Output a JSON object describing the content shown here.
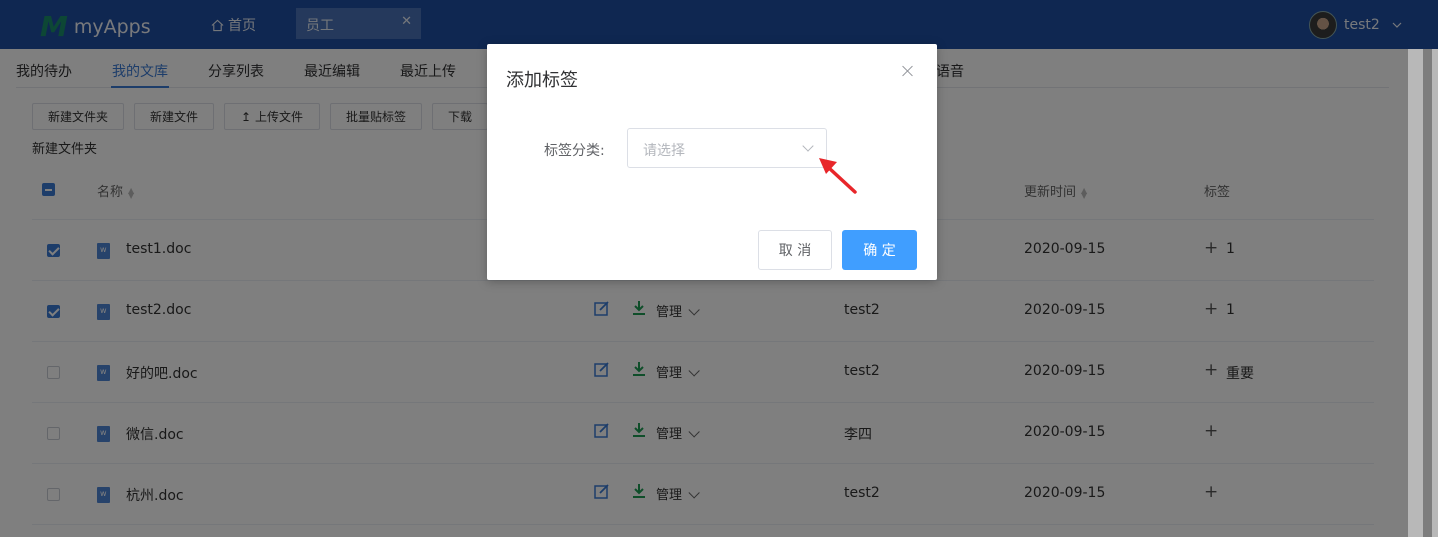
{
  "header": {
    "logo_mark": "M",
    "app_name": "myApps",
    "home_label": "首页",
    "active_tab": "员工",
    "user_name": "test2"
  },
  "subnav": {
    "items": [
      "我的待办",
      "我的文库",
      "分享列表",
      "最近编辑",
      "最近上传",
      "语音"
    ],
    "active_index": 1
  },
  "toolbar": {
    "buttons": [
      "新建文件夹",
      "新建文件",
      "上传文件",
      "批量贴标签",
      "下载"
    ],
    "breadcrumb": "新建文件夹"
  },
  "table": {
    "headers": {
      "name": "名称",
      "updated": "更新时间",
      "tags": "标签"
    },
    "manage_label": "管理",
    "rows": [
      {
        "name": "test1.doc",
        "owner": "",
        "updated": "2020-09-15",
        "tag": "1",
        "checked": true
      },
      {
        "name": "test2.doc",
        "owner": "test2",
        "updated": "2020-09-15",
        "tag": "1",
        "checked": true
      },
      {
        "name": "好的吧.doc",
        "owner": "test2",
        "updated": "2020-09-15",
        "tag": "重要",
        "checked": false
      },
      {
        "name": "微信.doc",
        "owner": "李四",
        "updated": "2020-09-15",
        "tag": "",
        "checked": false
      },
      {
        "name": "杭州.doc",
        "owner": "test2",
        "updated": "2020-09-15",
        "tag": "",
        "checked": false
      }
    ]
  },
  "dialog": {
    "title": "添加标签",
    "field_label": "标签分类:",
    "select_placeholder": "请选择",
    "cancel_label": "取 消",
    "ok_label": "确 定"
  },
  "colors": {
    "header_bg": "#1f4ea3",
    "accent": "#3a7bd5",
    "primary_button": "#409eff",
    "pointer_arrow": "#e8262a"
  }
}
